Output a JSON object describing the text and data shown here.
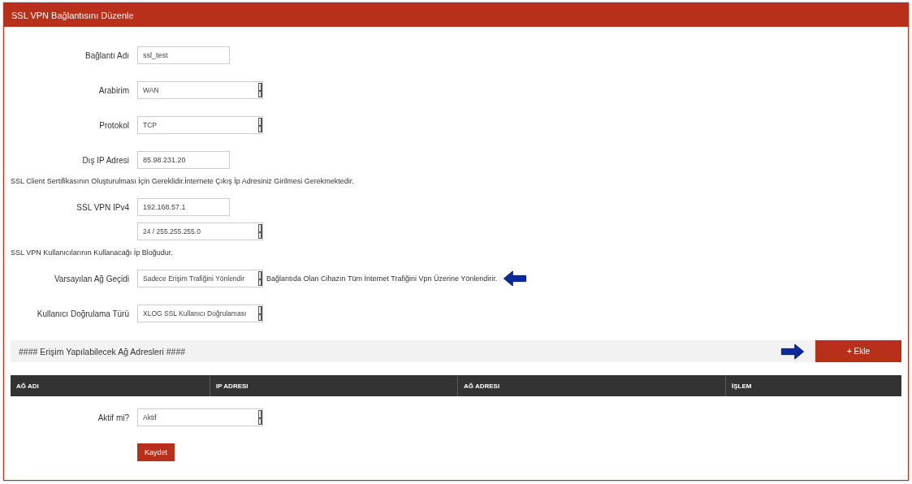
{
  "panel": {
    "title": "SSL VPN Bağlantısını Düzenle"
  },
  "form": [
    {
      "kind": "text",
      "label": "Bağlantı Adı",
      "value": "ssl_test"
    },
    {
      "kind": "select",
      "label": "Arabirim",
      "value": "WAN"
    },
    {
      "kind": "select",
      "label": "Protokol",
      "value": "TCP"
    },
    {
      "kind": "text",
      "label": "Dış IP Adresi",
      "value": "85.98.231.20"
    },
    {
      "kind": "hint",
      "text": "SSL Client Sertifikasının Oluşturulması İçin Gereklidir.İnternete Çıkış İp Adresiniz Girilmesi Gerekmektedir."
    },
    {
      "kind": "text",
      "label": "SSL VPN IPv4",
      "value": "192.168.57.1"
    },
    {
      "kind": "select",
      "value": "24 / 255.255.255.0"
    },
    {
      "kind": "hint",
      "text": "SSL VPN Kullanıcılarının Kullanacağı İp Bloğudur."
    },
    {
      "kind": "select",
      "label": "Varsayılan Ağ Geçidi",
      "value": "Sadece Erişim Trafiğini Yönlendir",
      "note": "Bağlantıda Olan Cihazın Tüm İnternet Trafiğini Vpn Üzerine Yönlendirir."
    },
    {
      "kind": "select",
      "label": "Kullanıcı Doğrulama Türü",
      "value": "XLOG SSL Kullanıcı Doğrulaması"
    }
  ],
  "section": {
    "title": "#### Erişim Yapılabilecek Ağ Adresleri ####",
    "add_button": "+ Ekle"
  },
  "table": {
    "columns": [
      "AĞ ADI",
      "IP ADRESI",
      "AĞ ADRESI",
      "İŞLEM"
    ]
  },
  "status": {
    "label": "Aktif mi?",
    "value": "Aktif"
  },
  "save_button": "Kaydet"
}
